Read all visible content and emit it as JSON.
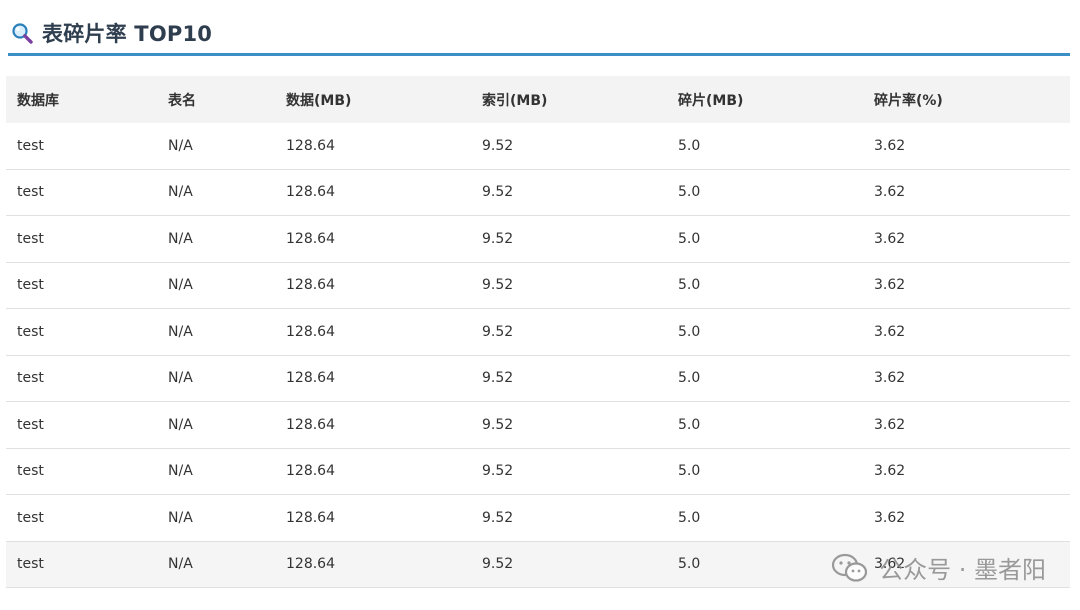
{
  "header": {
    "icon": "search-icon",
    "title": "表碎片率 TOP10"
  },
  "table": {
    "columns": [
      "数据库",
      "表名",
      "数据(MB)",
      "索引(MB)",
      "碎片(MB)",
      "碎片率(%)"
    ],
    "rows": [
      [
        "test",
        "N/A",
        "128.64",
        "9.52",
        "5.0",
        "3.62"
      ],
      [
        "test",
        "N/A",
        "128.64",
        "9.52",
        "5.0",
        "3.62"
      ],
      [
        "test",
        "N/A",
        "128.64",
        "9.52",
        "5.0",
        "3.62"
      ],
      [
        "test",
        "N/A",
        "128.64",
        "9.52",
        "5.0",
        "3.62"
      ],
      [
        "test",
        "N/A",
        "128.64",
        "9.52",
        "5.0",
        "3.62"
      ],
      [
        "test",
        "N/A",
        "128.64",
        "9.52",
        "5.0",
        "3.62"
      ],
      [
        "test",
        "N/A",
        "128.64",
        "9.52",
        "5.0",
        "3.62"
      ],
      [
        "test",
        "N/A",
        "128.64",
        "9.52",
        "5.0",
        "3.62"
      ],
      [
        "test",
        "N/A",
        "128.64",
        "9.52",
        "5.0",
        "3.62"
      ],
      [
        "test",
        "N/A",
        "128.64",
        "9.52",
        "5.0",
        "3.62"
      ]
    ]
  },
  "watermark": {
    "icon": "wechat-icon",
    "text": "公众号 · 墨者阳"
  },
  "colors": {
    "accent_line": "#3a8fc7",
    "header_bg": "#f3f3f3",
    "title_text": "#2f3e4f"
  }
}
